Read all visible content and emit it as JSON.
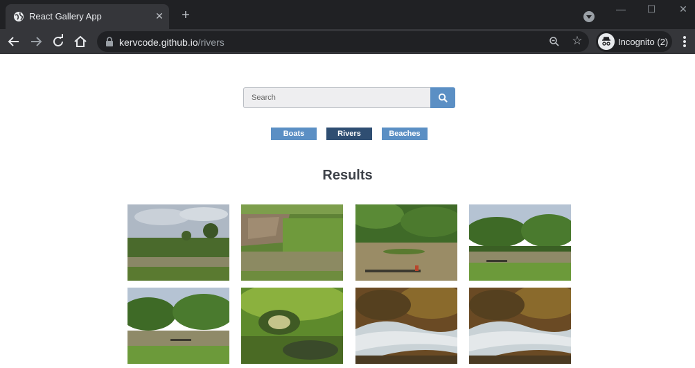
{
  "browser": {
    "tab_title": "React Gallery App",
    "url_host": "kervcode.github.io",
    "url_path": "/rivers",
    "incognito_label": "Incognito (2)"
  },
  "search": {
    "placeholder": "Search"
  },
  "nav": [
    {
      "label": "Boats",
      "active": false
    },
    {
      "label": "Rivers",
      "active": true
    },
    {
      "label": "Beaches",
      "active": false
    }
  ],
  "results_heading": "Results",
  "colors": {
    "accent": "#5b8fc4",
    "active": "#2f4e72",
    "chrome_dark": "#202124",
    "chrome_tab": "#35363a"
  },
  "icons": [
    "globe-icon",
    "close-icon",
    "plus-icon",
    "back-arrow-icon",
    "forward-arrow-icon",
    "reload-icon",
    "home-icon",
    "lock-icon",
    "zoom-icon",
    "star-icon",
    "incognito-icon",
    "kebab-menu-icon",
    "search-icon"
  ]
}
